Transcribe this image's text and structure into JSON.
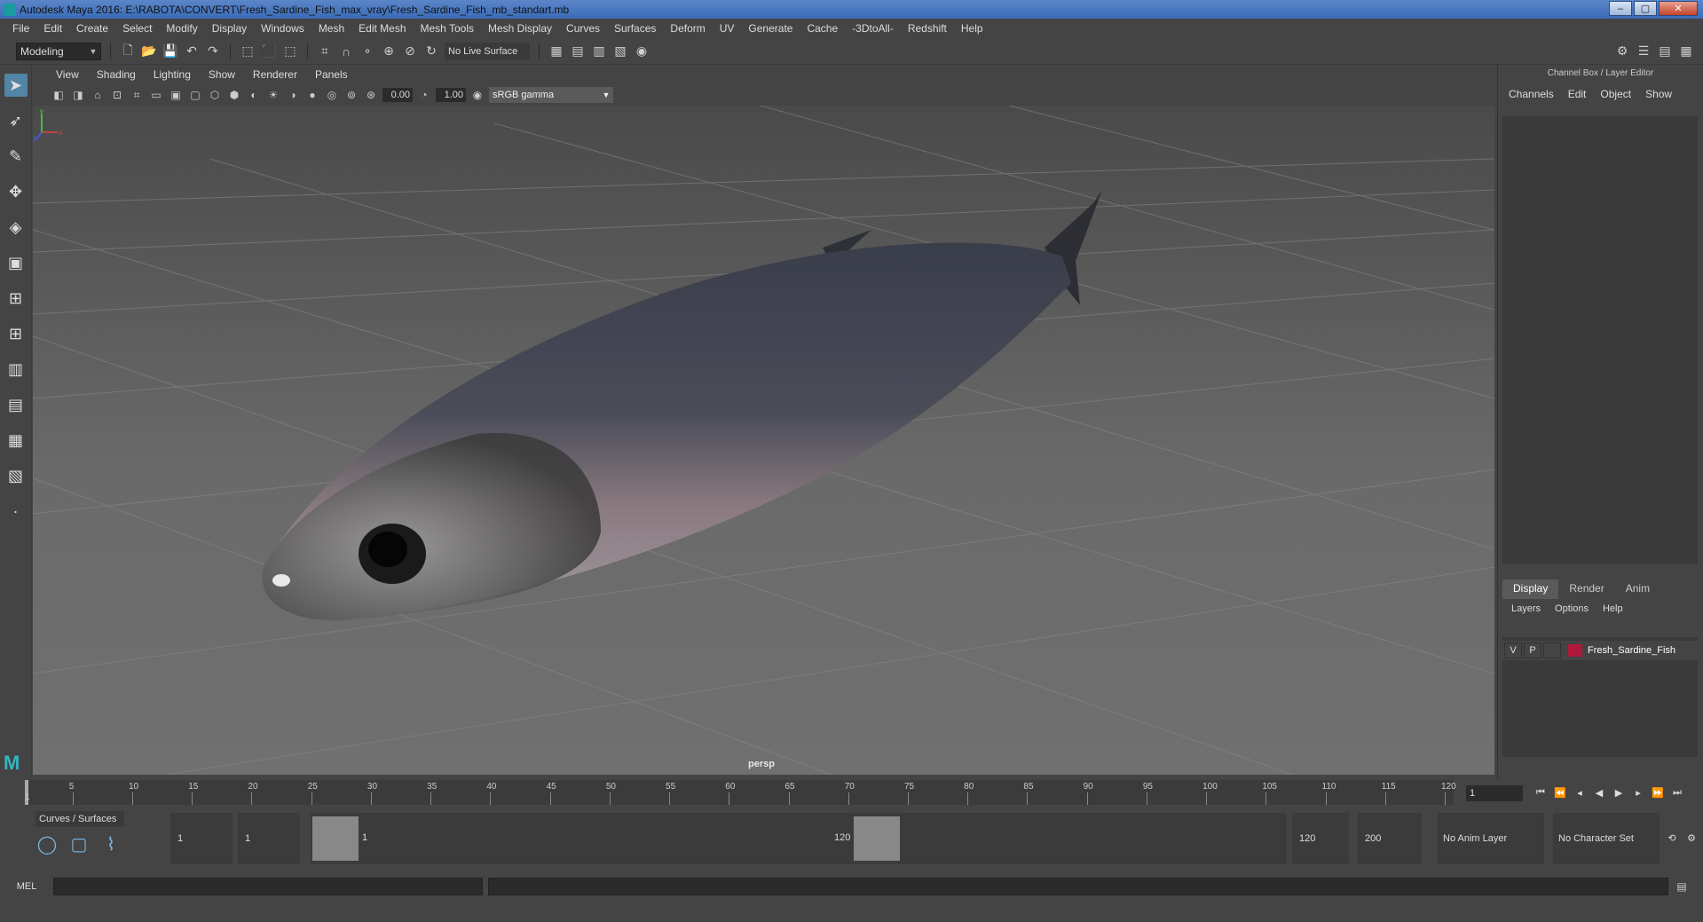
{
  "title_bar": {
    "title": "Autodesk Maya 2016: E:\\RABOTA\\CONVERT\\Fresh_Sardine_Fish_max_vray\\Fresh_Sardine_Fish_mb_standart.mb",
    "minimize": "‒",
    "maximize": "▢",
    "close": "✕"
  },
  "menu": [
    "File",
    "Edit",
    "Create",
    "Select",
    "Modify",
    "Display",
    "Windows",
    "Mesh",
    "Edit Mesh",
    "Mesh Tools",
    "Mesh Display",
    "Curves",
    "Surfaces",
    "Deform",
    "UV",
    "Generate",
    "Cache",
    "-3DtoAll-",
    "Redshift",
    "Help"
  ],
  "shelf": {
    "mode": "Modeling",
    "live_surface": "No Live Surface"
  },
  "viewport": {
    "menu": [
      "View",
      "Shading",
      "Lighting",
      "Show",
      "Renderer",
      "Panels"
    ],
    "exposure": "0.00",
    "gamma_value": "1.00",
    "color_space": "sRGB gamma",
    "camera": "persp",
    "axis_x": "x",
    "axis_y": "y",
    "axis_z": "z"
  },
  "channel_box": {
    "header": "Channel Box / Layer Editor",
    "menu": [
      "Channels",
      "Edit",
      "Object",
      "Show"
    ]
  },
  "layer_editor": {
    "tabs": [
      "Display",
      "Render",
      "Anim"
    ],
    "menu": [
      "Layers",
      "Options",
      "Help"
    ],
    "layer": {
      "v": "V",
      "p": "P",
      "name": "Fresh_Sardine_Fish",
      "color": "#b0183c"
    }
  },
  "time_slider": {
    "ticks": [
      "5",
      "10",
      "15",
      "20",
      "25",
      "30",
      "35",
      "40",
      "45",
      "50",
      "55",
      "60",
      "65",
      "70",
      "75",
      "80",
      "85",
      "90",
      "95",
      "100",
      "105",
      "110",
      "115",
      "120"
    ],
    "start_marker": "1",
    "current_frame": "1"
  },
  "range": {
    "shelf_tab": "Curves / Surfaces",
    "start": "1",
    "playback_start": "1",
    "slider_start": "1",
    "slider_end": "120",
    "playback_end": "120",
    "end": "200",
    "anim_layer": "No Anim Layer",
    "character_set": "No Character Set"
  },
  "command_line": {
    "label": "MEL"
  }
}
